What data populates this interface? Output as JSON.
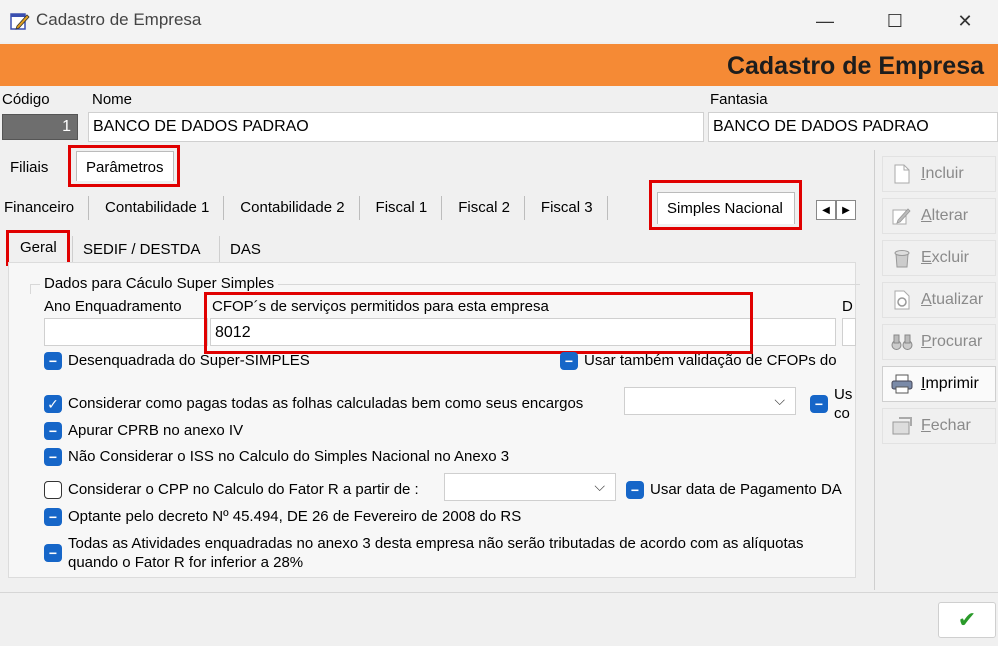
{
  "window": {
    "title": "Cadastro de Empresa",
    "minimize": "—",
    "maximize": "☐",
    "close": "✕"
  },
  "banner": {
    "title": "Cadastro de Empresa",
    "color": "#f58a35"
  },
  "header": {
    "codigo_label": "Código",
    "codigo_value": "1",
    "nome_label": "Nome",
    "nome_value": "BANCO DE DADOS PADRAO",
    "fantasia_label": "Fantasia",
    "fantasia_value": "BANCO DE DADOS PADRAO"
  },
  "top_tabs": [
    "Filiais",
    "Parâmetros"
  ],
  "param_tabs": [
    "Financeiro",
    "Contabilidade 1",
    "Contabilidade 2",
    "Fiscal 1",
    "Fiscal 2",
    "Fiscal 3",
    "Simples Nacional"
  ],
  "sub_tabs": [
    "Geral",
    "SEDIF / DESTDA",
    "DAS"
  ],
  "panel": {
    "group_title": "Dados para Cáculo Super Simples",
    "ano_label": "Ano Enquadramento",
    "ano_value": "",
    "cfop_label": "CFOP´s de serviços permitidos para esta empresa",
    "cfop_value": "8012",
    "right_cut_label": "D",
    "options": [
      {
        "label": "Desenquadrada do Super-SIMPLES",
        "state": "indeterminate"
      },
      {
        "label": "Usar também validação de CFOPs do",
        "state": "indeterminate"
      },
      {
        "label": "Considerar como pagas todas as folhas calculadas bem como seus encargos",
        "state": "checked"
      },
      {
        "label": "Us",
        "label2": "co",
        "state": "indeterminate"
      },
      {
        "label": "Apurar CPRB no anexo IV",
        "state": "indeterminate"
      },
      {
        "label": "Não Considerar o ISS no Calculo do Simples Nacional no Anexo 3",
        "state": "indeterminate"
      },
      {
        "label": "Considerar o CPP no Calculo do Fator R a partir de :",
        "state": "unchecked"
      },
      {
        "label": "Usar data de Pagamento DA",
        "state": "indeterminate"
      },
      {
        "label": "Optante pelo decreto  Nº 45.494, DE 26 de Fevereiro de 2008 do RS",
        "state": "indeterminate"
      },
      {
        "label": "Todas as Atividades enquadradas no anexo 3 desta empresa não serão tributadas de acordo com as alíquotas",
        "label2": "quando o Fator R for inferior a 28%",
        "state": "indeterminate"
      }
    ]
  },
  "side_buttons": [
    {
      "key": "I",
      "rest": "ncluir",
      "icon": "document-icon",
      "enabled": false
    },
    {
      "key": "A",
      "rest": "lterar",
      "icon": "edit-icon",
      "enabled": false
    },
    {
      "key": "E",
      "rest": "xcluir",
      "icon": "trash-icon",
      "enabled": false
    },
    {
      "key": "A",
      "rest": "tualizar",
      "icon": "refresh-icon",
      "enabled": false
    },
    {
      "key": "P",
      "rest": "rocurar",
      "icon": "binoculars-icon",
      "enabled": false
    },
    {
      "key": "I",
      "rest": "mprimir",
      "icon": "printer-icon",
      "enabled": true
    },
    {
      "key": "F",
      "rest": "echar",
      "icon": "close-door-icon",
      "enabled": false
    }
  ],
  "ok_button": "✔",
  "scroll_arrows": [
    "◀",
    "▶"
  ],
  "combo_chevron": "⌵"
}
